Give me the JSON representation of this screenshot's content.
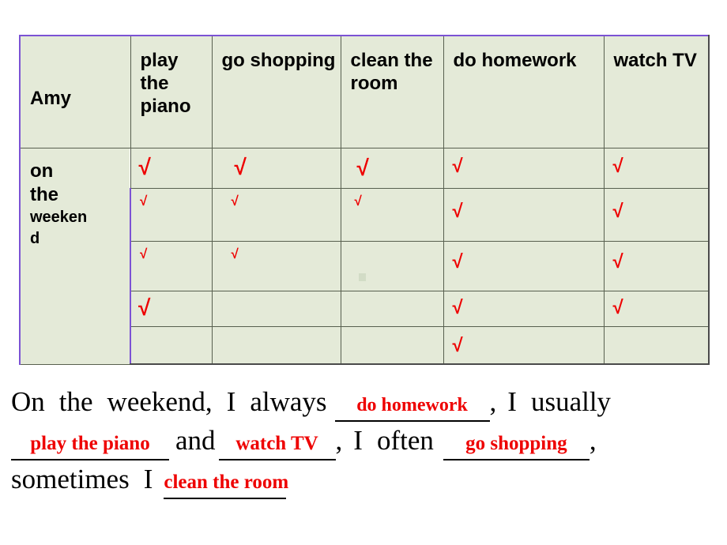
{
  "table": {
    "headers": [
      {
        "id": "name",
        "label": "Amy"
      },
      {
        "id": "act1",
        "label": "play the piano"
      },
      {
        "id": "act2",
        "label": "go shopping"
      },
      {
        "id": "act3",
        "label": "clean the room"
      },
      {
        "id": "act4",
        "label": "do homework"
      },
      {
        "id": "act5",
        "label": "watch TV"
      }
    ],
    "row_label": {
      "line1": "on",
      "line2": "the",
      "line3": "weeken",
      "line4": "d"
    },
    "check_mark": "√",
    "check_color": "#ee0000",
    "cell_background": "#e4ead8",
    "border_color": "#58604f",
    "accent_border_color": "#7b52d4",
    "rows": [
      {
        "play_the_piano": true,
        "go_shopping": true,
        "clean_the_room": true,
        "do_homework": true,
        "watch_tv": true
      },
      {
        "play_the_piano": true,
        "go_shopping": true,
        "clean_the_room": true,
        "do_homework": true,
        "watch_tv": true
      },
      {
        "play_the_piano": true,
        "go_shopping": true,
        "clean_the_room": false,
        "do_homework": true,
        "watch_tv": true
      },
      {
        "play_the_piano": true,
        "go_shopping": false,
        "clean_the_room": false,
        "do_homework": true,
        "watch_tv": true
      },
      {
        "play_the_piano": false,
        "go_shopping": false,
        "clean_the_room": false,
        "do_homework": true,
        "watch_tv": false
      }
    ],
    "totals": {
      "play_the_piano": 4,
      "go_shopping": 3,
      "clean_the_room": 2,
      "do_homework": 5,
      "watch_tv": 4
    }
  },
  "sentence": {
    "t1": "On",
    "t2": "the",
    "t3": "weekend,",
    "t4": "I",
    "t5": "always",
    "answer1": "do  homework",
    "t6": ",",
    "t7": "I",
    "t8": "usually",
    "answer2": "play the piano",
    "t9": "and",
    "answer3": "watch TV",
    "t10": ",",
    "t11": "I",
    "t12": "often",
    "answer4": "go shopping",
    "t13": ",",
    "t14": "sometimes",
    "t15": "I",
    "answer5": "clean the room",
    "answer_color": "#ee0000"
  }
}
